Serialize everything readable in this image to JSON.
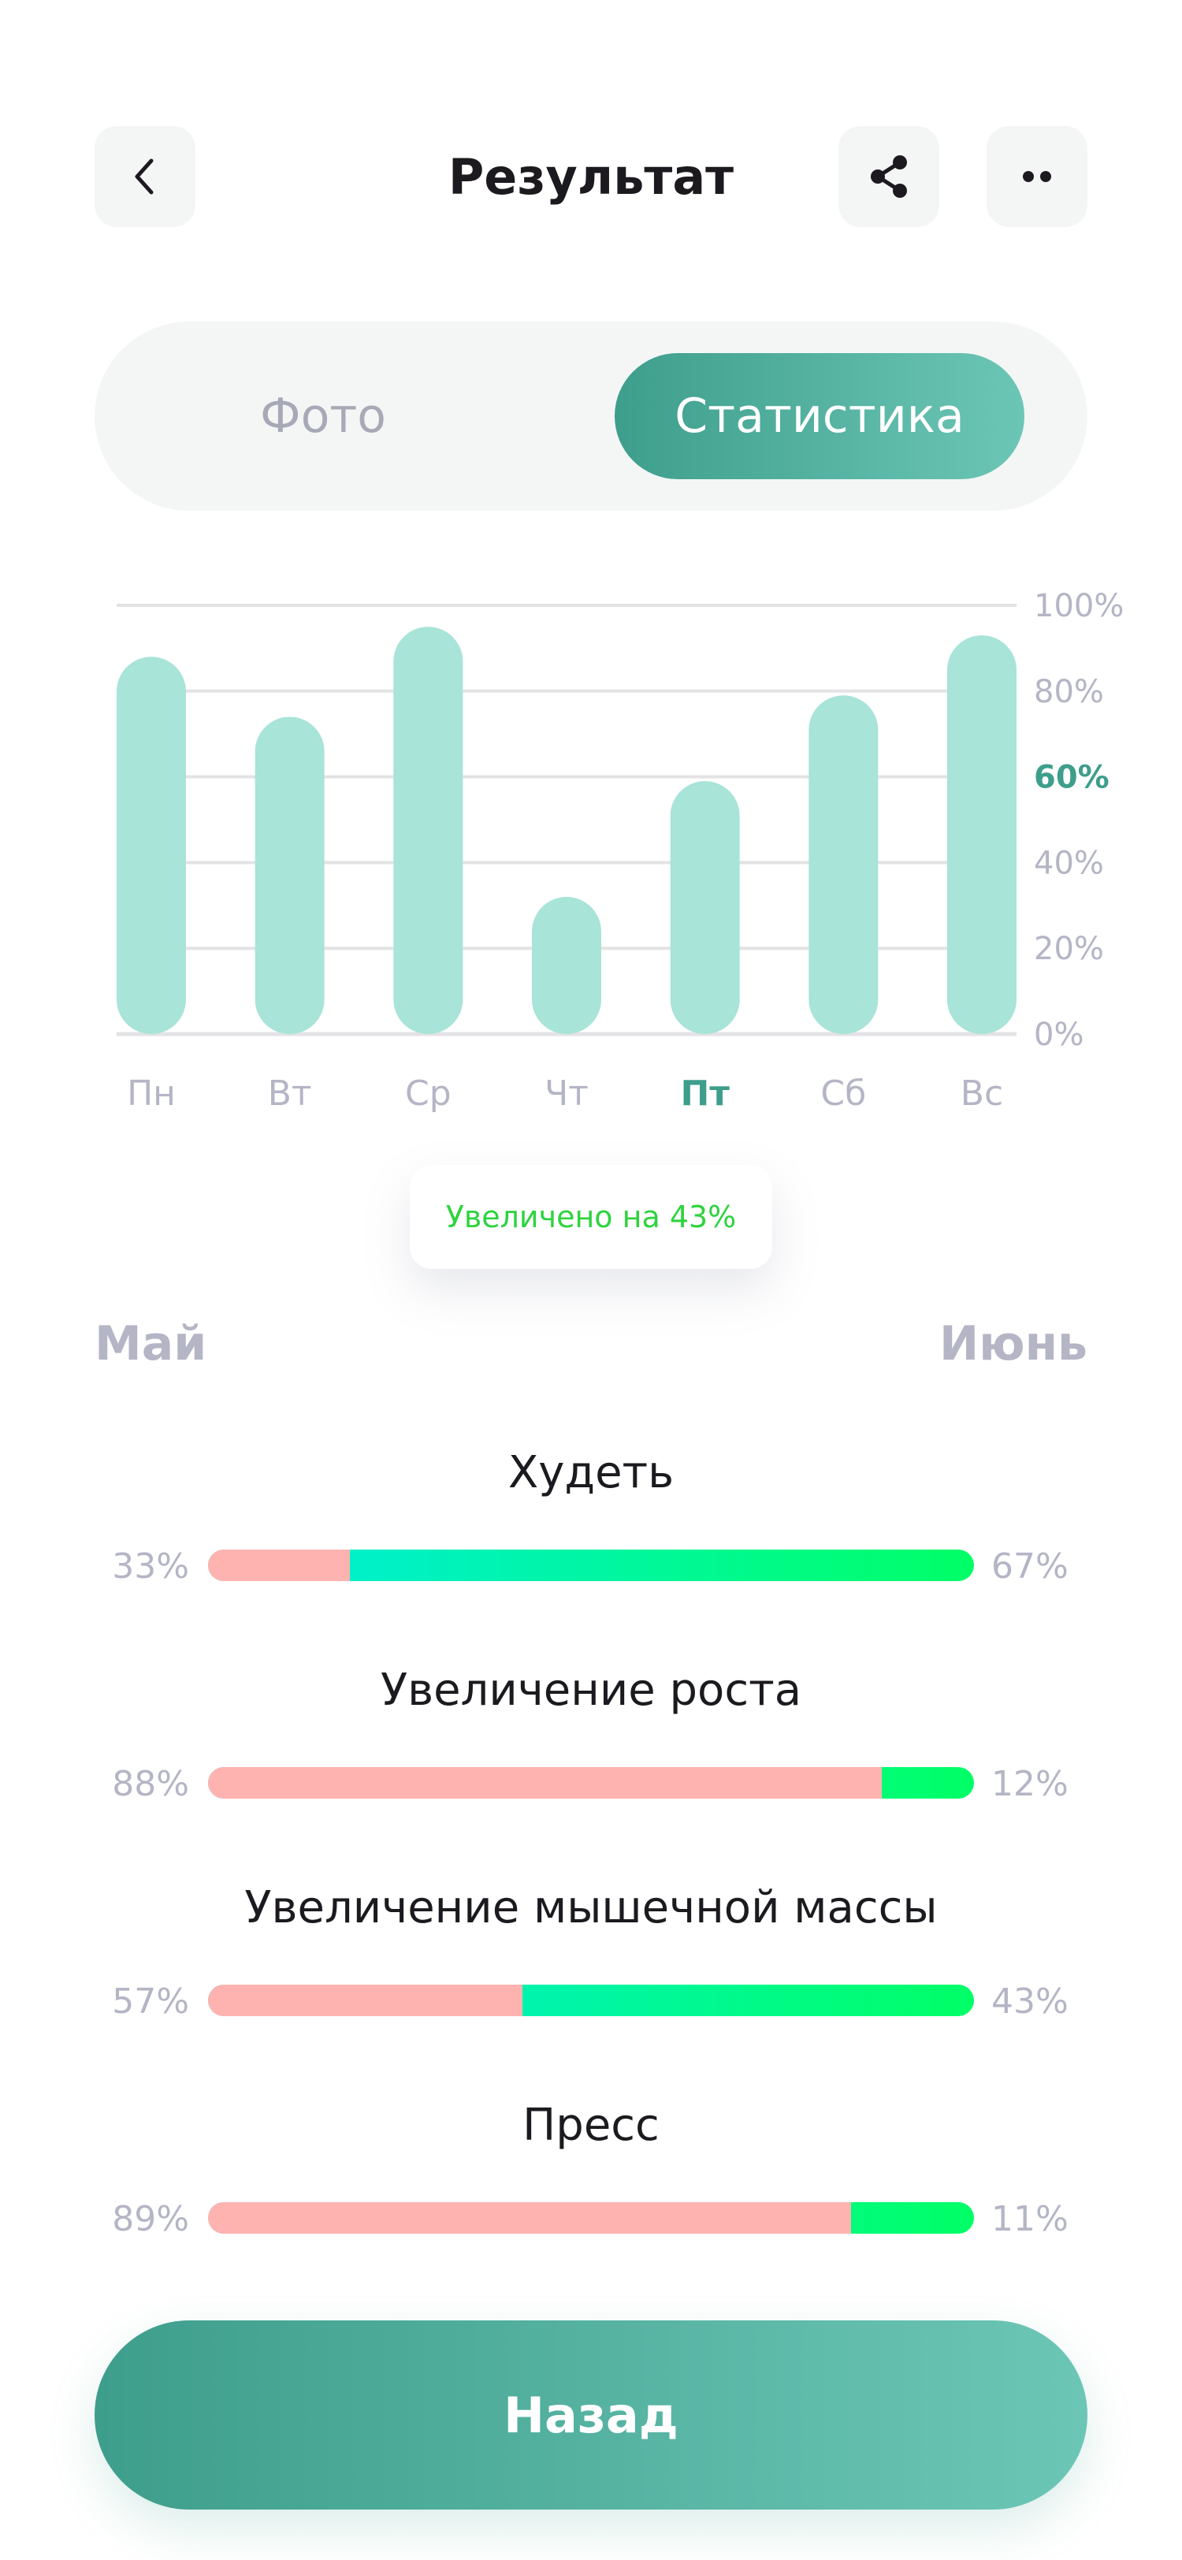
{
  "header": {
    "title": "Результат",
    "back_icon": "chevron-left-icon",
    "share_icon": "share-icon",
    "more_icon": "more-dots-icon"
  },
  "segment": {
    "photo_label": "Фото",
    "stats_label": "Статистика",
    "selected": "Статистика"
  },
  "chart_data": {
    "type": "bar",
    "categories": [
      "Пн",
      "Вт",
      "Ср",
      "Чт",
      "Пт",
      "Сб",
      "Вс"
    ],
    "values": [
      88,
      74,
      95,
      32,
      59,
      79,
      93
    ],
    "highlighted_category": "Пт",
    "highlighted_tick": "60%",
    "yticks": [
      "0%",
      "20%",
      "40%",
      "60%",
      "80%",
      "100%"
    ],
    "ylim": [
      0,
      100
    ],
    "grid": true,
    "colors": {
      "bar": "#a8e4d8",
      "grid": "#e3e3e6",
      "tick": "#b4b5c5",
      "highlight": "#3e9e8c"
    }
  },
  "tooltip": {
    "text": "Увеличено на 43%"
  },
  "months": {
    "left": "Май",
    "right": "Июнь"
  },
  "goals": [
    {
      "title": "Худеть",
      "before": "33%",
      "after": "67%",
      "before_fraction": 0.185
    },
    {
      "title": "Увеличение роста",
      "before": "88%",
      "after": "12%",
      "before_fraction": 0.88
    },
    {
      "title": "Увеличение мышечной массы",
      "before": "57%",
      "after": "43%",
      "before_fraction": 0.41
    },
    {
      "title": "Пресс",
      "before": "89%",
      "after": "11%",
      "before_fraction": 0.84
    }
  ],
  "colors": {
    "accent": "#3e9e8c",
    "accent_light": "#6cc6b6",
    "bar_before": "#ffb3b0",
    "bar_after_start": "#00ede0",
    "bar_after_end": "#00ff66",
    "increase_text": "#2ed33f"
  },
  "cta": {
    "label": "Назад"
  }
}
